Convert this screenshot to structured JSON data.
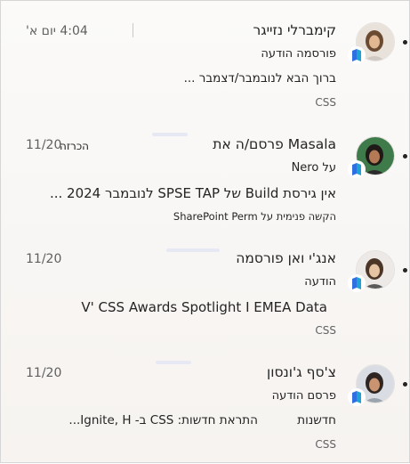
{
  "items": [
    {
      "sender": "קימברלי נזייגר",
      "time": "4:04 יום א'",
      "line2": "פורסמה הודעה",
      "line3": "ברוך הבא לנובמבר/דצמבר ...",
      "line4": "CSS",
      "unread": true
    },
    {
      "sender": "Masala פרסם/ה את",
      "time": "11/20",
      "line2": "הכרזה",
      "line2b": "על Nero",
      "line3": "אין גירסת Build של SPSE TAP לנובמבר 2024 ...",
      "line4": "הקשה פנימית על SharePoint Perm",
      "unread": true
    },
    {
      "sender": "אנג'י ואן פורסמה",
      "time": "11/20",
      "line2": "הודעה",
      "line3": "V' CSS Awards Spotlight I EMEA Data",
      "line4": "CSS",
      "unread": true
    },
    {
      "sender": "צ'סף ג'ונסון",
      "time": "11/20",
      "line2": "פרסם הודעה",
      "line3a": "חדשנות",
      "line3b": "התראת חדשות: CSS ב- Ignite, H...",
      "line4": "CSS",
      "unread": true
    }
  ],
  "app_icon": "copilot-icon",
  "colors": {
    "accent_blue": "#2f6fe0",
    "accent_teal": "#1fa3d6",
    "text": "#242424",
    "muted": "#616161"
  }
}
